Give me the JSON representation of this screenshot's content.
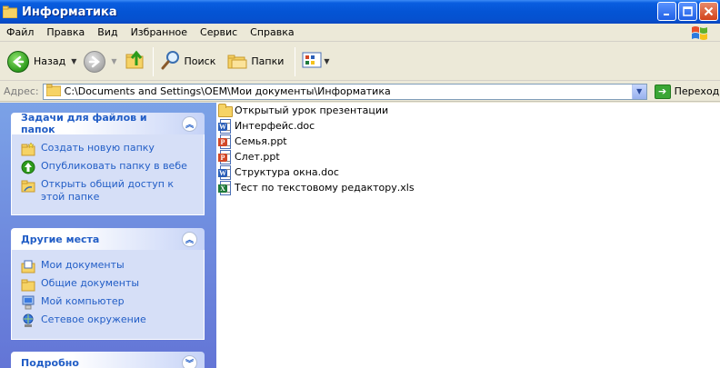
{
  "window": {
    "title": "Информатика"
  },
  "menu": [
    "Файл",
    "Правка",
    "Вид",
    "Избранное",
    "Сервис",
    "Справка"
  ],
  "toolbar": {
    "back_label": "Назад",
    "search_label": "Поиск",
    "folders_label": "Папки"
  },
  "address": {
    "label": "Адрес:",
    "path": "C:\\Documents and Settings\\OEM\\Мои документы\\Информатика",
    "go_label": "Переход"
  },
  "tasks_panel": {
    "title": "Задачи для файлов и папок",
    "items": [
      {
        "label": "Создать новую папку",
        "icon": "new-folder-icon"
      },
      {
        "label": "Опубликовать папку в вебе",
        "icon": "web-publish-icon"
      },
      {
        "label": "Открыть общий доступ к этой папке",
        "icon": "share-folder-icon"
      }
    ]
  },
  "places_panel": {
    "title": "Другие места",
    "items": [
      {
        "label": "Мои документы",
        "icon": "my-documents-icon"
      },
      {
        "label": "Общие документы",
        "icon": "shared-documents-icon"
      },
      {
        "label": "Мой компьютер",
        "icon": "my-computer-icon"
      },
      {
        "label": "Сетевое окружение",
        "icon": "network-icon"
      }
    ]
  },
  "details_panel": {
    "title": "Подробно"
  },
  "files": [
    {
      "name": "Открытый урок презентации",
      "type": "folder"
    },
    {
      "name": "Интерфейс.doc",
      "type": "doc"
    },
    {
      "name": "Семья.ppt",
      "type": "ppt"
    },
    {
      "name": "Слет.ppt",
      "type": "ppt"
    },
    {
      "name": "Структура окна.doc",
      "type": "doc"
    },
    {
      "name": "Тест по текстовому редактору.xls",
      "type": "xls"
    }
  ],
  "colors": {
    "titlebar": "#0454d4",
    "task_link": "#215dc6",
    "pane_top": "#7ba2e7",
    "pane_bottom": "#6375d6"
  }
}
